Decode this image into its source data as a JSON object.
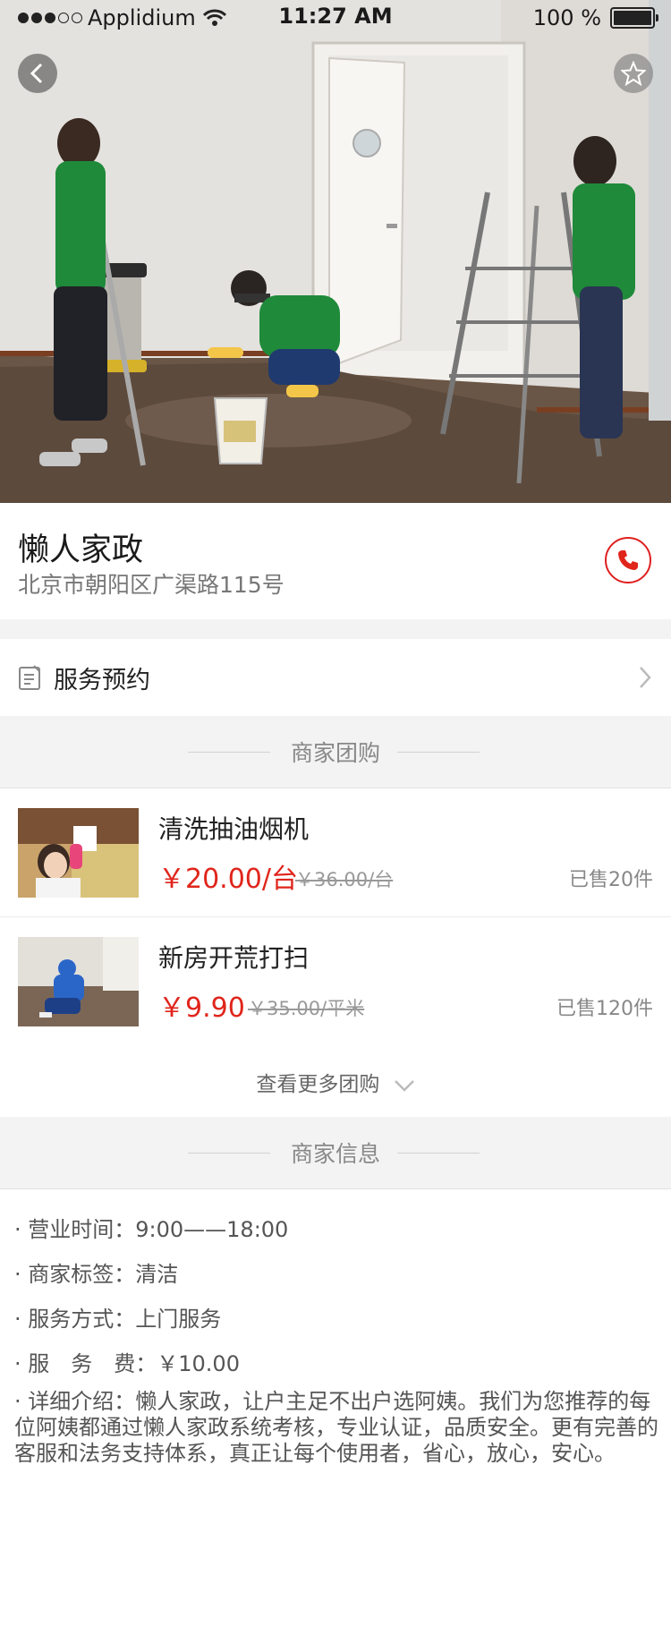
{
  "status_bar": {
    "carrier": "Applidium",
    "time": "11:27 AM",
    "battery": "100 %"
  },
  "hero": {
    "back_icon": "chevron-left-icon",
    "favorite_icon": "star-icon"
  },
  "shop": {
    "name": "懒人家政",
    "address": "北京市朝阳区广渠路115号",
    "call_icon": "phone-icon"
  },
  "booking": {
    "label": "服务预约"
  },
  "group_buy": {
    "section_title": "商家团购",
    "deals": [
      {
        "title": "清洗抽油烟机",
        "price": "￥20.00/台",
        "original_price": "￥36.00/台",
        "sold": "已售20件"
      },
      {
        "title": "新房开荒打扫",
        "price": "￥9.90",
        "original_price": "￥35.00/平米",
        "sold": "已售120件"
      }
    ],
    "more_label": "查看更多团购"
  },
  "merchant_info": {
    "section_title": "商家信息",
    "rows": [
      {
        "key": "· 营业时间：",
        "value": "9:00——18:00"
      },
      {
        "key": "· 商家标签：",
        "value": "清洁"
      },
      {
        "key": "· 服务方式：",
        "value": "上门服务"
      },
      {
        "key": "· 服　务　费：",
        "value": "￥10.00"
      }
    ],
    "description": "· 详细介绍：懒人家政，让户主足不出户选阿姨。我们为您推荐的每位阿姨都通过懒人家政系统考核，专业认证，品质安全。更有完善的客服和法务支持体系，真正让每个使用者，省心，放心，安心。"
  },
  "colors": {
    "accent_red": "#e0251b",
    "section_bg": "#f3f3f3",
    "divider": "#e2e2e2"
  }
}
